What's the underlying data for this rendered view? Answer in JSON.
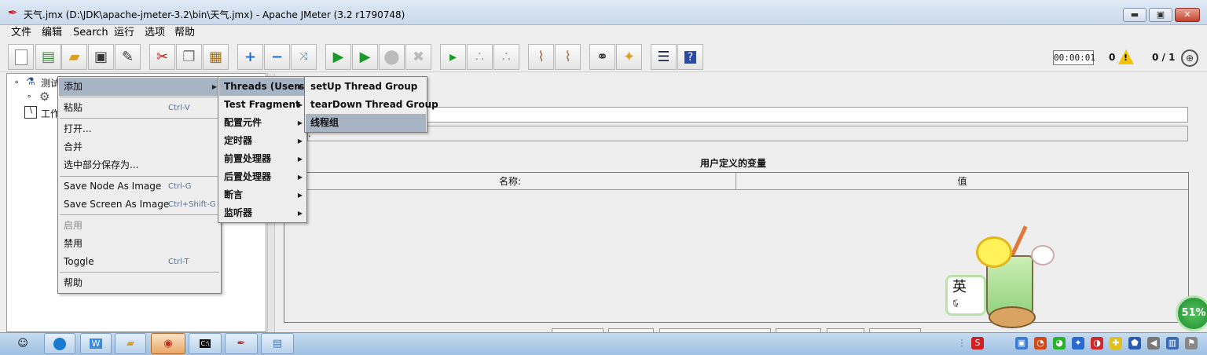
{
  "window": {
    "title": "天气.jmx (D:\\JDK\\apache-jmeter-3.2\\bin\\天气.jmx) - Apache JMeter (3.2 r1790748)",
    "controls": {
      "minimize": "▬",
      "maximize": "▣",
      "close": "✕"
    }
  },
  "menubar": [
    "文件",
    "编辑",
    "Search",
    "运行",
    "选项",
    "帮助"
  ],
  "toolbar": {
    "icons": [
      "new-icon",
      "templates-icon",
      "open-icon",
      "save-icon",
      "save-as-icon",
      "cut-icon",
      "copy-icon",
      "paste-icon",
      "expand-icon",
      "collapse-icon",
      "toggle-icon",
      "start-icon",
      "start-no-pause-icon",
      "stop-icon",
      "shutdown-icon",
      "remote-start-icon",
      "remote-stop-icon",
      "remote-shutdown-icon",
      "clear-icon",
      "clear-all-icon",
      "search-icon",
      "reset-search-icon",
      "function-helper-icon",
      "help-icon"
    ],
    "timer": "00:00:01",
    "error_count": "0",
    "warn_mark": "!",
    "threads": "0 / 1",
    "expand_symbol": "⊕"
  },
  "tree": {
    "items": [
      {
        "label": "测试"
      },
      {
        "label": ""
      },
      {
        "label": "工作"
      }
    ]
  },
  "context_menu": {
    "items": [
      {
        "label": "添加",
        "shortcut": "",
        "submenu": true
      },
      {
        "label": "粘贴",
        "shortcut": "Ctrl-V"
      },
      {
        "label": "打开...",
        "shortcut": ""
      },
      {
        "label": "合并",
        "shortcut": ""
      },
      {
        "label": "选中部分保存为...",
        "shortcut": ""
      },
      {
        "label": "Save Node As Image",
        "shortcut": "Ctrl-G"
      },
      {
        "label": "Save Screen As Image",
        "shortcut": "Ctrl+Shift-G"
      },
      {
        "label": "启用",
        "shortcut": ""
      },
      {
        "label": "禁用",
        "shortcut": ""
      },
      {
        "label": "Toggle",
        "shortcut": "Ctrl-T"
      },
      {
        "label": "帮助",
        "shortcut": ""
      }
    ]
  },
  "add_submenu": {
    "items": [
      "Threads (Users)",
      "Test Fragment",
      "配置元件",
      "定时器",
      "前置处理器",
      "后置处理器",
      "断言",
      "监听器"
    ]
  },
  "threads_submenu": {
    "items": [
      "setUp Thread Group",
      "tearDown Thread Group",
      "线程组"
    ]
  },
  "editor": {
    "vars_title": "用户定义的变量",
    "columns": [
      "名称:",
      "值"
    ],
    "colon_fragment": ":"
  },
  "sticker": {
    "ime_char": "英",
    "ime_sub": "·,",
    "ime_moon": "☾"
  },
  "taskbar": {
    "tray_badge": "51%"
  }
}
